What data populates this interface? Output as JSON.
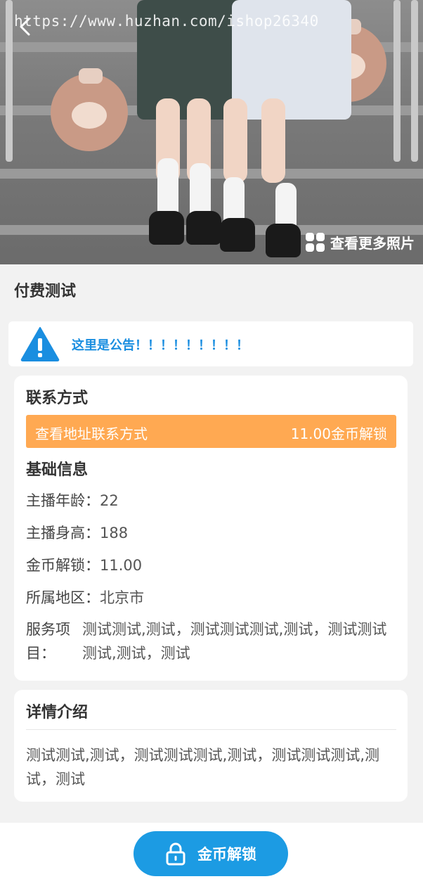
{
  "hero": {
    "watermark": "https://www.huzhan.com/ishop26340",
    "more_photos_label": "查看更多照片"
  },
  "page_title": "付费测试",
  "notice": {
    "text": "这里是公告！！！！！！！！！",
    "color": "#1a8ee0"
  },
  "contact": {
    "title": "联系方式",
    "unlock_label": "查看地址联系方式",
    "unlock_price": "11.00金币解锁",
    "bar_color": "#ffa952"
  },
  "basic_info": {
    "title": "基础信息",
    "rows": [
      {
        "label": "主播年龄：",
        "value": "22"
      },
      {
        "label": "主播身高：",
        "value": "188"
      },
      {
        "label": "金币解锁：",
        "value": "11.00"
      },
      {
        "label": "所属地区：",
        "value": "北京市"
      }
    ],
    "service_label": "服务项目：",
    "service_value": "测试测试,测试，测试测试测试,测试，测试测试测试,测试，测试"
  },
  "detail": {
    "title": "详情介绍",
    "text": "测试测试,测试，测试测试测试,测试，测试测试测试,测试，测试"
  },
  "footer": {
    "unlock_button": "金币解锁",
    "button_color": "#1c9be3"
  }
}
